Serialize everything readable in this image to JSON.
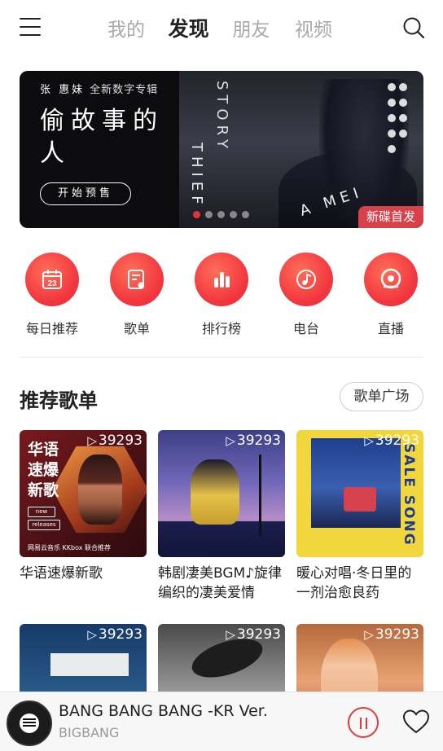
{
  "nav": {
    "tabs": [
      "我的",
      "发现",
      "朋友",
      "视频"
    ],
    "active_tab": "发现"
  },
  "banner": {
    "artist": "张 惠妹",
    "subtitle": "全新数字专辑",
    "title": "偷故事的人",
    "button": "开始预售",
    "story": "STORY",
    "thief": "THIEF",
    "amei": "A MEI",
    "badge": "新碟首发",
    "page_count": 5,
    "current_page": 1
  },
  "shortcuts": [
    {
      "label": "每日推荐",
      "icon": "calendar-icon",
      "day": "23"
    },
    {
      "label": "歌单",
      "icon": "playlist-icon"
    },
    {
      "label": "排行榜",
      "icon": "chart-bars-icon"
    },
    {
      "label": "电台",
      "icon": "radio-icon"
    },
    {
      "label": "直播",
      "icon": "live-icon"
    }
  ],
  "section": {
    "title": "推荐歌单",
    "more_button": "歌单广场"
  },
  "playlists": [
    {
      "name": "华语速爆新歌",
      "plays": "39293",
      "cover_text": "华语速爆新歌",
      "pill1": "new",
      "pill2": "releases",
      "cover_footer": "网易云音乐 KKbox 联合推荐"
    },
    {
      "name": "韩剧凄美BGM♪旋律编织的凄美爱情",
      "plays": "39293"
    },
    {
      "name": "暖心对唱·冬日里的一剂治愈良药",
      "plays": "39293",
      "cover_text": "SALE SONG"
    },
    {
      "name": "",
      "plays": "39293"
    },
    {
      "name": "",
      "plays": "39293"
    },
    {
      "name": "",
      "plays": "39293"
    }
  ],
  "player": {
    "song": "BANG BANG BANG -KR Ver.",
    "artist": "BIGBANG"
  },
  "colors": {
    "accent": "#e4383f",
    "badge": "#d8414a"
  }
}
